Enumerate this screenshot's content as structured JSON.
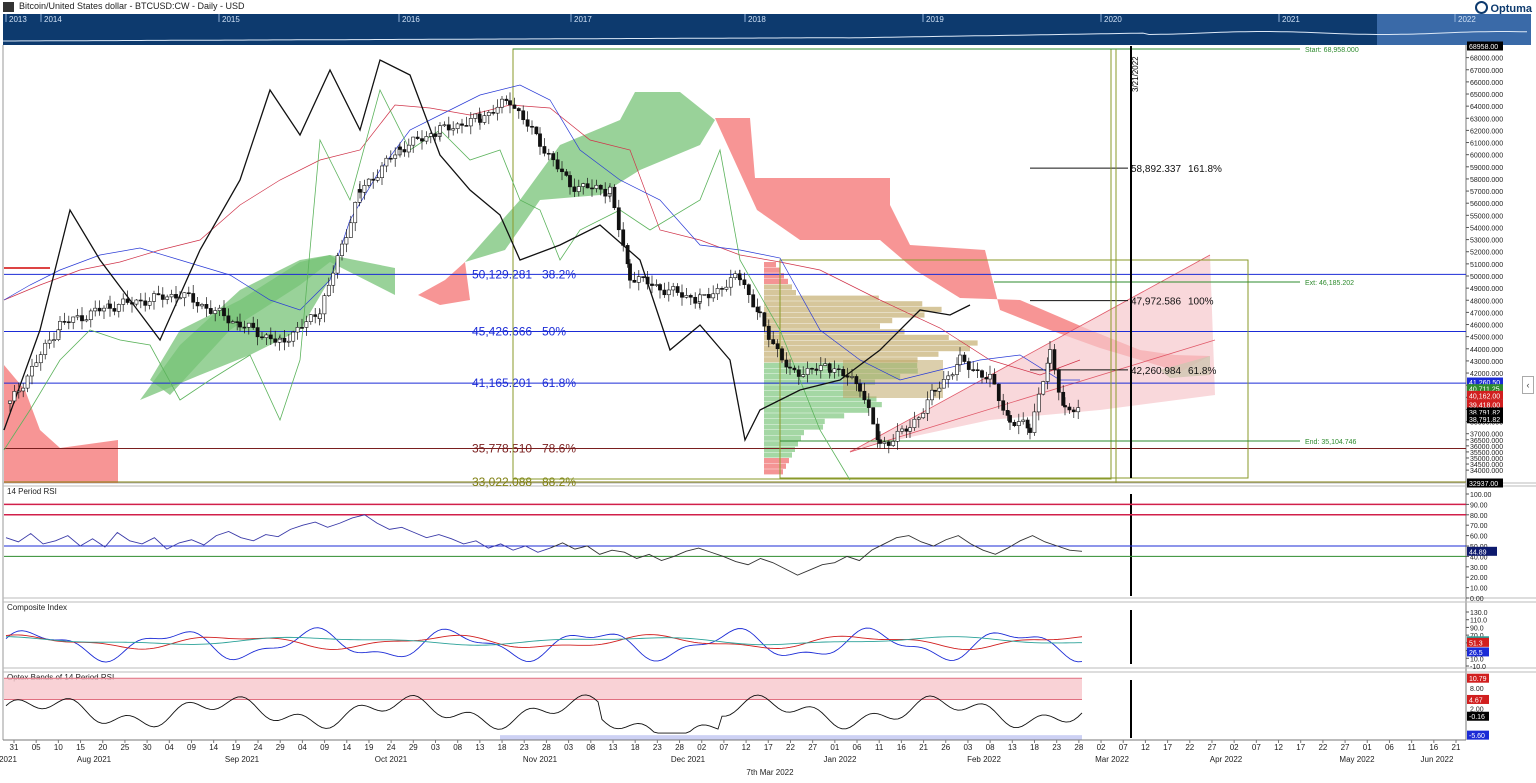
{
  "window": {
    "title": "Bitcoin/United States dollar - BTCUSD:CW - Daily - USD",
    "brand": "Optuma"
  },
  "navigator": {
    "years": [
      "2013",
      "2014",
      "2015",
      "2016",
      "2017",
      "2018",
      "2019",
      "2020",
      "2021",
      "2022"
    ]
  },
  "chart_data": [
    {
      "type": "candlestick",
      "title": "Bitcoin/United States dollar - BTCUSD:CW - Daily - USD",
      "ylim": [
        32937,
        68958
      ],
      "y_ticks": [
        34000,
        34500,
        35000,
        35500,
        36000,
        36500,
        37000,
        38000,
        39000,
        40000,
        41000,
        42000,
        43000,
        44000,
        45000,
        46000,
        47000,
        48000,
        49000,
        50000,
        51000,
        52000,
        53000,
        54000,
        55000,
        56000,
        57000,
        58000,
        59000,
        60000,
        61000,
        62000,
        63000,
        64000,
        65000,
        66000,
        67000,
        68000
      ],
      "y_tick_labels": [
        "34000.000",
        "34500.000",
        "35000.000",
        "35500.000",
        "36000.000",
        "36500.000",
        "37000.000",
        "38000.000",
        "39000.000",
        "40000.000",
        "41000.000",
        "42000.000",
        "43000.000",
        "44000.000",
        "45000.000",
        "46000.000",
        "47000.000",
        "48000.000",
        "49000.000",
        "50000.000",
        "51000.000",
        "52000.000",
        "53000.000",
        "54000.000",
        "55000.000",
        "56000.000",
        "57000.000",
        "58000.000",
        "59000.000",
        "60000.000",
        "61000.000",
        "62000.000",
        "63000.000",
        "64000.000",
        "65000.000",
        "66000.000",
        "67000.000",
        "68000.000"
      ],
      "axis_boxes": [
        {
          "label": "68958.00",
          "value": 68958,
          "color": "#000000"
        },
        {
          "label": "41,260.50",
          "value": 41260.5,
          "color": "#1b2bd6"
        },
        {
          "label": "40,711.25",
          "value": 40711.25,
          "color": "#2e8b2e"
        },
        {
          "label": "40,162.00",
          "value": 40162,
          "color": "#d11f1f"
        },
        {
          "label": "39,418.00",
          "value": 39418,
          "color": "#d11f1f"
        },
        {
          "label": "38,791.82",
          "value": 38791.82,
          "color": "#000000"
        },
        {
          "label": "38,791.82",
          "value": 38230,
          "color": "#000000"
        },
        {
          "label": "32937.00",
          "value": 32937,
          "color": "#000000"
        }
      ],
      "fib_retracement": [
        {
          "price": "50,129.281",
          "pct": "38.2%",
          "value": 50129.281,
          "color": "#1b2bd6"
        },
        {
          "price": "45,426.666",
          "pct": "50%",
          "value": 45426.666,
          "color": "#1b2bd6"
        },
        {
          "price": "41,165.201",
          "pct": "61.8%",
          "value": 41165.201,
          "color": "#1b2bd6"
        },
        {
          "price": "35,778.510",
          "pct": "78.6%",
          "value": 35778.51,
          "color": "#7a1f1f"
        },
        {
          "price": "33,022.088",
          "pct": "88.2%",
          "value": 33022.088,
          "color": "#7f7f10"
        }
      ],
      "fib_extension": [
        {
          "price": "58,892.337",
          "pct": "161.8%",
          "value": 58892.337
        },
        {
          "price": "47,972.586",
          "pct": "100%",
          "value": 47972.586
        },
        {
          "price": "42,260.984",
          "pct": "61.8%",
          "value": 42260.984
        }
      ],
      "annotations": {
        "start": "Start: 68,958.000",
        "ext": "Ext: 46,185.202",
        "end": "End: 35,104.746",
        "vline_date": "3/21/2022"
      }
    },
    {
      "type": "line",
      "title": "14 Period RSI",
      "ylim": [
        0,
        100
      ],
      "y_ticks": [
        0,
        10,
        20,
        30,
        40,
        50,
        60,
        70,
        80,
        90,
        100
      ],
      "y_tick_labels": [
        "0.00",
        "10.00",
        "20.00",
        "30.00",
        "40.00",
        "50.00",
        "60.00",
        "70.00",
        "80.00",
        "90.00",
        "100.00"
      ],
      "levels": [
        90,
        80,
        50,
        40
      ],
      "last_value": {
        "label": "44.89",
        "value": 44.89
      },
      "series": [
        {
          "values": [
            58,
            54,
            62,
            52,
            55,
            60,
            50,
            57,
            49,
            63,
            55,
            52,
            58,
            47,
            53,
            56,
            51,
            60,
            64,
            58,
            55,
            61,
            59,
            66,
            70,
            73,
            68,
            72,
            77,
            80,
            72,
            66,
            68,
            63,
            58,
            61,
            57,
            52,
            55,
            48,
            52,
            46,
            50,
            44,
            48,
            53,
            47,
            50,
            42,
            46,
            44,
            38,
            42,
            36,
            40,
            45,
            48,
            44,
            40,
            35,
            32,
            38,
            34,
            28,
            22,
            27,
            32,
            34,
            40,
            36,
            46,
            52,
            58,
            60,
            54,
            50,
            56,
            60,
            52,
            46,
            42,
            48,
            55,
            60,
            54,
            50,
            46,
            44.89
          ]
        }
      ]
    },
    {
      "type": "line",
      "title": "Composite Index",
      "ylim": [
        -10,
        130
      ],
      "y_ticks": [
        -10,
        10,
        30,
        50,
        70,
        90,
        110,
        130
      ],
      "y_tick_labels": [
        "-10.0",
        "10.0",
        "30.0",
        "50.0",
        "70.0",
        "90.0",
        "110.0",
        "130.0"
      ],
      "last_values": [
        {
          "label": "55.4",
          "value": 55.4,
          "color": "#2aa198"
        },
        {
          "label": "51.3",
          "value": 51.3,
          "color": "#d11f1f"
        },
        {
          "label": "26.5",
          "value": 26.5,
          "color": "#1b2bd6"
        }
      ]
    },
    {
      "type": "line",
      "title": "Optex Bands of 14 Period RSI",
      "ylim": [
        -7,
        12
      ],
      "y_ticks": [
        2,
        8
      ],
      "y_tick_labels": [
        "2.00",
        "8.00"
      ],
      "last_values": [
        {
          "label": "10.79",
          "value": 10.79,
          "color": "#d11f1f"
        },
        {
          "label": "4.67",
          "value": 4.67,
          "color": "#d11f1f"
        },
        {
          "label": "-0.16",
          "value": -0.16,
          "color": "#000000"
        },
        {
          "label": "-5.60",
          "value": -5.6,
          "color": "#1b2bd6"
        }
      ]
    }
  ],
  "x_axis": {
    "day_labels": [
      "31",
      "05",
      "10",
      "15",
      "20",
      "25",
      "30",
      "04",
      "09",
      "14",
      "19",
      "24",
      "29",
      "04",
      "09",
      "14",
      "19",
      "24",
      "29",
      "03",
      "08",
      "13",
      "18",
      "23",
      "28",
      "03",
      "08",
      "13",
      "18",
      "23",
      "28",
      "02",
      "07",
      "12",
      "17",
      "22",
      "27",
      "01",
      "06",
      "11",
      "16",
      "21",
      "26",
      "03",
      "08",
      "13",
      "18",
      "23",
      "28",
      "02",
      "07",
      "12",
      "17",
      "22",
      "27",
      "02",
      "07",
      "12",
      "17",
      "22",
      "27",
      "01",
      "06",
      "11",
      "16",
      "21"
    ],
    "month_labels": [
      "2021",
      "Aug 2021",
      "Sep 2021",
      "Oct 2021",
      "Nov 2021",
      "Dec 2021",
      "Jan 2022",
      "Feb 2022",
      "Mar 2022",
      "Apr 2022",
      "May 2022",
      "Jun 2022"
    ],
    "cursor_date": "7th Mar 2022"
  }
}
